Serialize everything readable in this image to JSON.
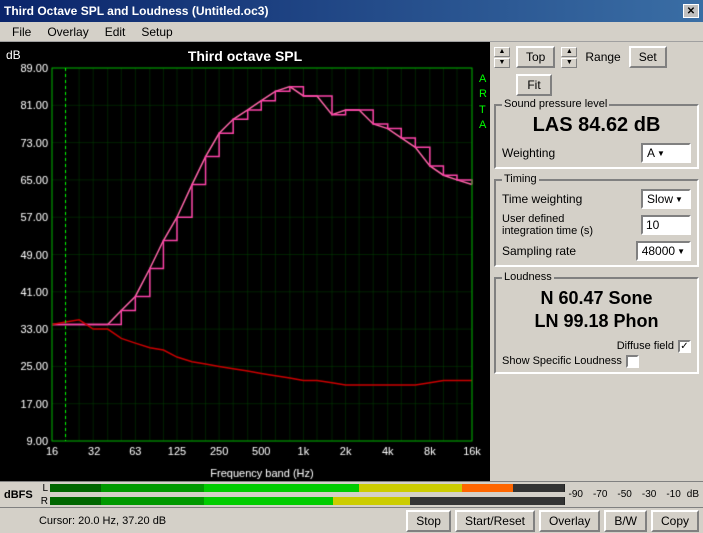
{
  "titleBar": {
    "title": "Third Octave SPL and Loudness (Untitled.oc3)",
    "closeLabel": "✕"
  },
  "menuBar": {
    "items": [
      "File",
      "Overlay",
      "Edit",
      "Setup"
    ]
  },
  "topControls": {
    "topLabel": "Top",
    "fitLabel": "Fit",
    "rangeLabel": "Range",
    "setLabel": "Set"
  },
  "spl": {
    "groupLabel": "Sound pressure level",
    "value": "LAS 84.62 dB",
    "weightingLabel": "Weighting",
    "weightingValue": "A"
  },
  "timing": {
    "groupLabel": "Timing",
    "timeWeightingLabel": "Time weighting",
    "timeWeightingValue": "Slow",
    "integrationLabel": "User defined\nintegration time (s)",
    "integrationValue": "10",
    "samplingLabel": "Sampling rate",
    "samplingValue": "48000"
  },
  "loudness": {
    "groupLabel": "Loudness",
    "value1": "N 60.47 Sone",
    "value2": "LN 99.18 Phon",
    "diffuseLabel": "Diffuse field",
    "diffuseChecked": true,
    "specificLabel": "Show Specific Loudness"
  },
  "chart": {
    "title": "Third octave SPL",
    "dbLabel": "dB",
    "sideLabels": [
      "A",
      "R",
      "T",
      "A"
    ],
    "yLabels": [
      "89.00",
      "81.00",
      "73.00",
      "65.00",
      "57.00",
      "49.00",
      "41.00",
      "33.00",
      "25.00",
      "17.00",
      "9.00"
    ],
    "xLabels": [
      "16",
      "32",
      "63",
      "125",
      "250",
      "500",
      "1k",
      "2k",
      "4k",
      "8k",
      "16k"
    ],
    "cursorLabel": "Cursor:  20.0 Hz, 37.20 dB"
  },
  "dbfs": {
    "label": "dBFS",
    "leftLabel": "L",
    "rightLabel": "R",
    "dbMarkers": [
      "-90",
      "-70",
      "-50",
      "-30",
      "-10"
    ]
  },
  "bottomBar": {
    "stopLabel": "Stop",
    "startResetLabel": "Start/Reset",
    "overlayLabel": "Overlay",
    "bwLabel": "B/W",
    "copyLabel": "Copy"
  }
}
